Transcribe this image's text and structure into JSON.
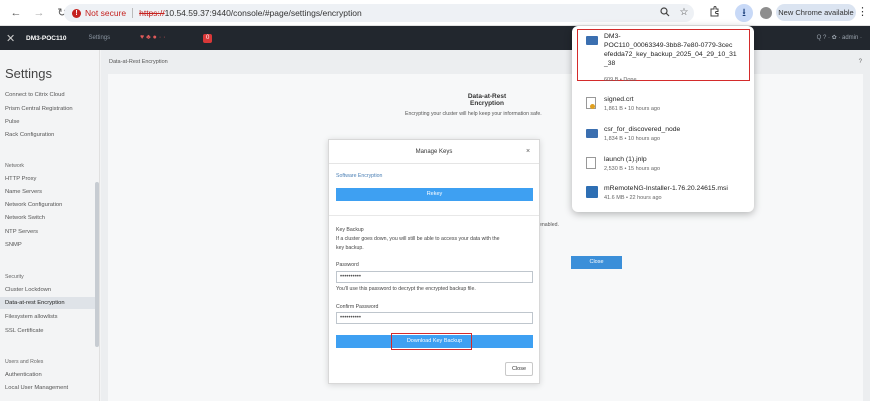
{
  "browser": {
    "nav": {
      "back": "←",
      "forward": "→",
      "reload": "↻"
    },
    "security_label": "Not secure",
    "url_scheme": "https://",
    "url_rest": "10.54.59.37:9440/console/#page/settings/encryption",
    "new_chrome_label": "New Chrome available",
    "menu_glyph": "⋮",
    "icons": {
      "zoom": "zoom-icon",
      "star": "star-icon",
      "extensions": "extensions-icon",
      "download": "download-icon"
    }
  },
  "prism": {
    "cluster_name": "DM3-POC110",
    "nav_settings": "Settings",
    "alert_glyph": "♥  ♣ ● · ·",
    "badge_count": "0",
    "right_text": "Q  ?  ·  ✿  ·  admin ·"
  },
  "sidebar": {
    "title": "Settings",
    "items_general": [
      "Connect to Citrix Cloud",
      "Prism Central Registration",
      "Pulse",
      "Rack Configuration"
    ],
    "network_head": "Network",
    "items_network": [
      "HTTP Proxy",
      "Name Servers",
      "Network Configuration",
      "Network Switch",
      "NTP Servers",
      "SNMP"
    ],
    "security_head": "Security",
    "items_security": [
      "Cluster Lockdown",
      "Data-at-rest Encryption",
      "Filesystem allowlists",
      "SSL Certificate"
    ],
    "users_head": "Users and Roles",
    "items_users": [
      "Authentication",
      "Local User Management"
    ]
  },
  "main": {
    "breadcrumb": "Data-at-Rest Encryption",
    "help": "?",
    "bg_title": "Data-at-Rest Encryption",
    "bg_desc": "Encrypting your cluster will help keep your information safe.",
    "bg_enabled": "enabled.",
    "bg_close": "Close"
  },
  "modal": {
    "title": "Manage Keys",
    "close_x": "×",
    "software_encryption": "Software Encryption",
    "rekey": "Rekey",
    "key_backup_head": "Key Backup",
    "key_backup_desc_1": "If a cluster goes down, you will still be able to access your data with the",
    "key_backup_desc_2": "key backup.",
    "password_label": "Password",
    "password_value": "••••••••••",
    "password_hint": "You'll use this password to decrypt the encrypted backup file.",
    "confirm_label": "Confirm Password",
    "confirm_value": "••••••••••",
    "download_btn": "Download Key Backup",
    "close_btn": "Close"
  },
  "downloads": {
    "items": [
      {
        "icon": "folder-icon",
        "name_1": "DM3-",
        "name_2": "POC110_00063349-3bb8-7e80-0779-3cec",
        "name_3": "efedda72_key_backup_2025_04_29_10_31",
        "name_4": "_38",
        "meta": "609 B • Done"
      },
      {
        "icon": "cert-icon",
        "name_1": "signed.crt",
        "meta": "1,861 B • 10 hours ago"
      },
      {
        "icon": "folder-icon",
        "name_1": "csr_for_discovered_node",
        "meta": "1,834 B • 10 hours ago"
      },
      {
        "icon": "doc-icon",
        "name_1": "launch (1).jnlp",
        "meta": "2,530 B • 15 hours ago"
      },
      {
        "icon": "app-icon",
        "name_1": "mRemoteNG-Installer-1.76.20.24615.msi",
        "meta": "41.6 MB • 22 hours ago"
      }
    ]
  }
}
